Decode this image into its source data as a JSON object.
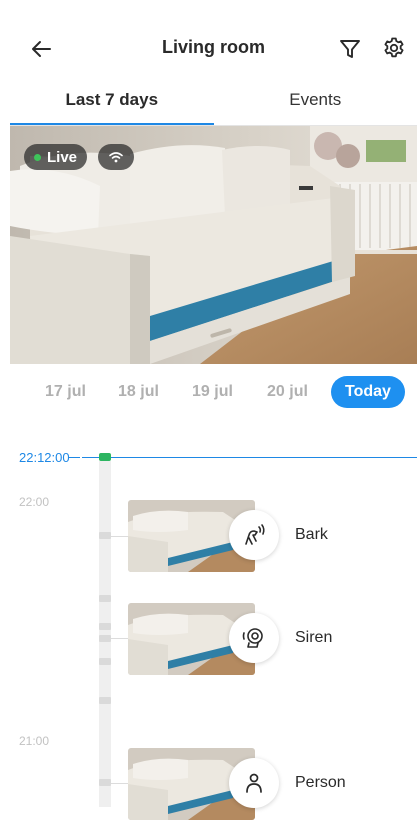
{
  "header": {
    "title": "Living room",
    "back_icon": "arrow-left-icon",
    "filter_icon": "filter-icon",
    "settings_icon": "gear-icon"
  },
  "tabs": [
    {
      "label": "Last 7 days",
      "active": true
    },
    {
      "label": "Events",
      "active": false
    }
  ],
  "live_view": {
    "badge_label": "Live",
    "status_icon": "wifi-icon",
    "live_dot_color": "#3ec45a"
  },
  "dates": [
    {
      "label": "17 jul",
      "selected": false
    },
    {
      "label": "18 jul",
      "selected": false
    },
    {
      "label": "19 jul",
      "selected": false
    },
    {
      "label": "20 jul",
      "selected": false
    },
    {
      "label": "Today",
      "selected": true
    }
  ],
  "timeline": {
    "current_time": "22:12:00",
    "hour_labels": [
      "22:00",
      "21:00"
    ],
    "events": [
      {
        "label": "Bark",
        "icon": "bark-icon"
      },
      {
        "label": "Siren",
        "icon": "siren-icon"
      },
      {
        "label": "Person",
        "icon": "person-icon"
      }
    ]
  },
  "colors": {
    "accent": "#1e88e5",
    "today_pill": "#1e90f0",
    "now_marker": "#2db561",
    "inactive_date": "#b0b0b0"
  }
}
